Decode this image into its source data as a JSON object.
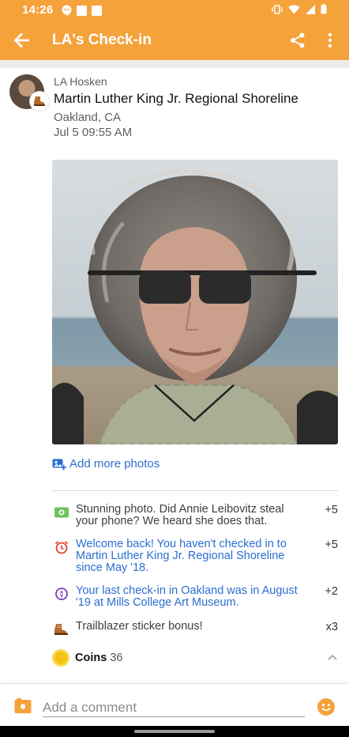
{
  "status_bar": {
    "time": "14:26"
  },
  "app_bar": {
    "title": "LA's Check-in"
  },
  "checkin": {
    "user_name": "LA Hosken",
    "venue_name": "Martin Luther King Jr. Regional Shoreline",
    "city": "Oakland, CA",
    "time": "Jul 5 09:55 AM"
  },
  "add_photos_label": "Add more photos",
  "points": [
    {
      "icon": "photo-bonus-icon",
      "text": "Stunning photo. Did Annie Leibovitz steal your phone? We heard she does that.",
      "value": "+5",
      "link": false
    },
    {
      "icon": "alarm-clock-icon",
      "text": "Welcome back! You haven't checked in to Martin Luther King Jr. Regional Shoreline since May '18.",
      "value": "+5",
      "link": true
    },
    {
      "icon": "compass-icon",
      "text": "Your last check-in in Oakland was in August '19 at Mills College Art Museum.",
      "value": "+2",
      "link": true
    },
    {
      "icon": "boot-icon",
      "text": "Trailblazer sticker bonus!",
      "value": "x3",
      "link": false
    }
  ],
  "coins": {
    "label": "Coins",
    "count": "36"
  },
  "comment": {
    "placeholder": "Add a comment",
    "value": ""
  },
  "colors": {
    "brand": "#f5a23b",
    "link": "#2b6ed1",
    "coin": "#f4c21b"
  }
}
